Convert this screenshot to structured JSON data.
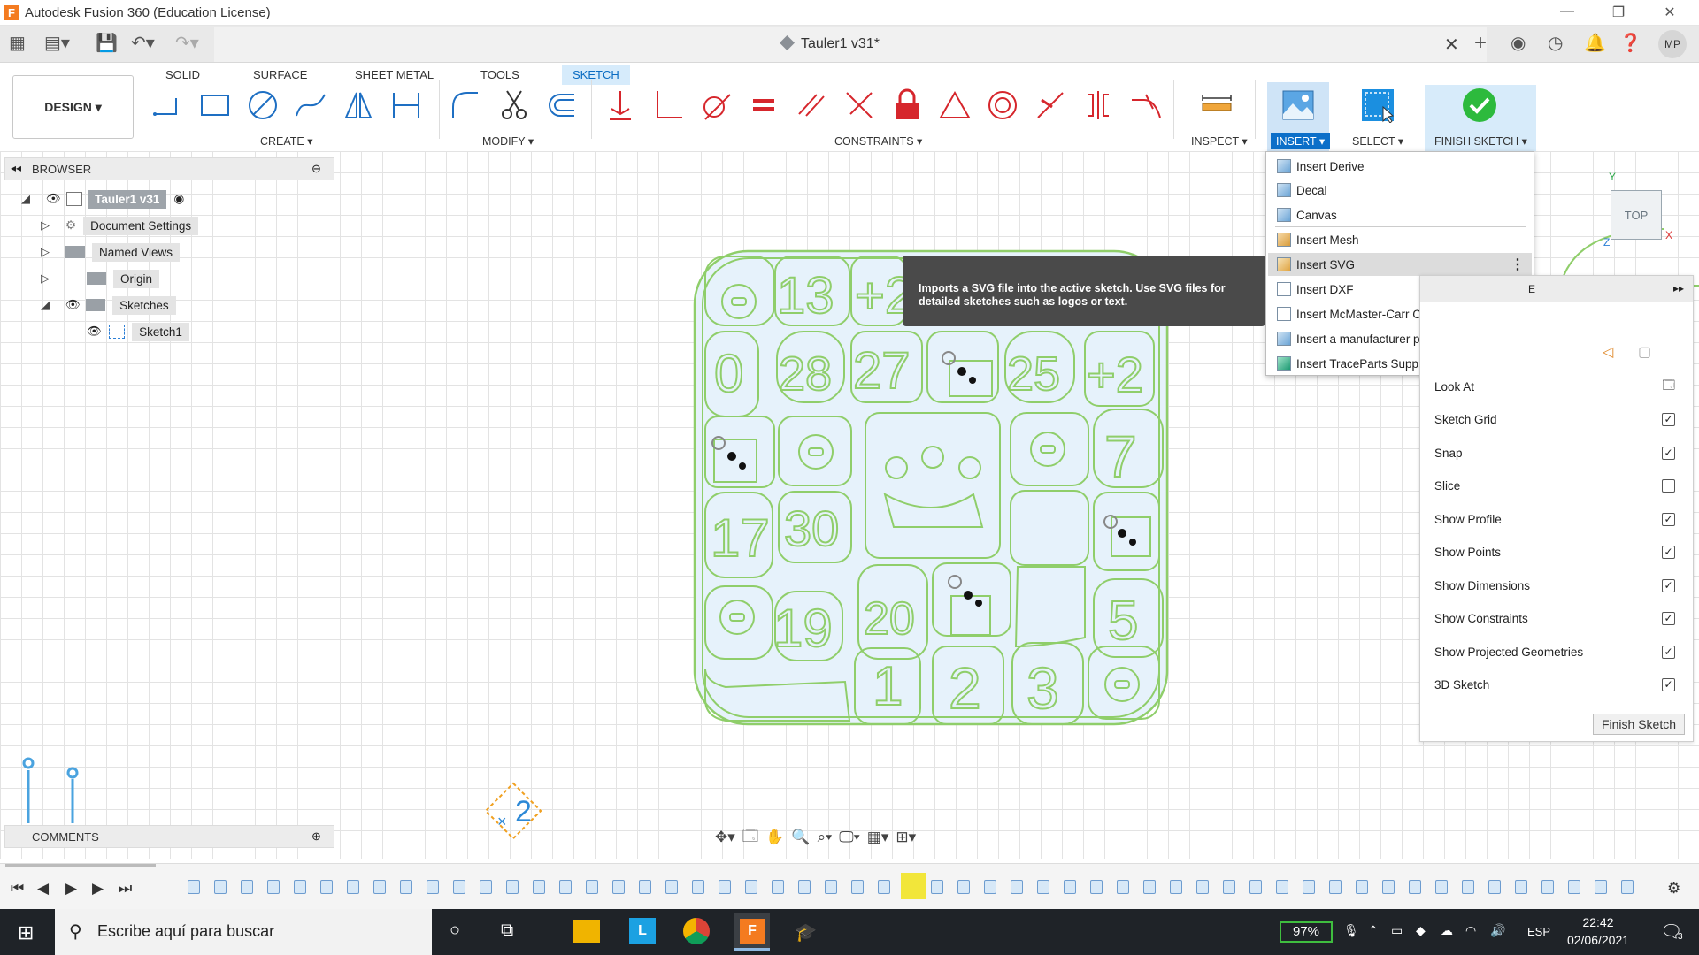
{
  "window": {
    "title": "Autodesk Fusion 360 (Education License)",
    "app_icon_letter": "F"
  },
  "document": {
    "tab_title": "Tauler1 v31*"
  },
  "user": {
    "initials": "MP"
  },
  "workspace": {
    "label": "DESIGN ▾"
  },
  "tabs": [
    {
      "label": "SOLID",
      "active": false
    },
    {
      "label": "SURFACE",
      "active": false
    },
    {
      "label": "SHEET METAL",
      "active": false
    },
    {
      "label": "TOOLS",
      "active": false
    },
    {
      "label": "SKETCH",
      "active": true
    }
  ],
  "groups": {
    "create": "CREATE ▾",
    "modify": "MODIFY ▾",
    "constraints": "CONSTRAINTS ▾",
    "inspect": "INSPECT ▾",
    "insert": "INSERT ▾",
    "select": "SELECT ▾",
    "finish": "FINISH SKETCH ▾"
  },
  "browser": {
    "title": "BROWSER",
    "items": [
      {
        "label": "Tauler1 v31",
        "icon": "component-icon",
        "expander": "◢"
      },
      {
        "label": "Document Settings",
        "icon": "gear-icon",
        "expander": "▷"
      },
      {
        "label": "Named Views",
        "icon": "folder-icon",
        "expander": "▷"
      },
      {
        "label": "Origin",
        "icon": "folder-icon",
        "expander": "▷"
      },
      {
        "label": "Sketches",
        "icon": "folder-icon",
        "expander": "◢"
      },
      {
        "label": "Sketch1",
        "icon": "sketch-icon",
        "expander": ""
      }
    ]
  },
  "comments": {
    "title": "COMMENTS"
  },
  "insert_menu": {
    "items": [
      {
        "label": "Insert Derive"
      },
      {
        "label": "Decal"
      },
      {
        "label": "Canvas"
      },
      {
        "label": "Insert Mesh"
      },
      {
        "label": "Insert SVG",
        "highlighted": true
      },
      {
        "label": "Insert DXF"
      },
      {
        "label": "Insert McMaster-Carr Component"
      },
      {
        "label": "Insert a manufacturer part"
      },
      {
        "label": "Insert TraceParts Supplier Components"
      }
    ]
  },
  "tooltip": {
    "text": "Imports a SVG file into the active sketch. Use SVG files for detailed sketches such as logos or text."
  },
  "sketch_palette": {
    "header_fragment": "E",
    "options": [
      {
        "label": "Look At",
        "checked": null
      },
      {
        "label": "Sketch Grid",
        "checked": true
      },
      {
        "label": "Snap",
        "checked": true
      },
      {
        "label": "Slice",
        "checked": false
      },
      {
        "label": "Show Profile",
        "checked": true
      },
      {
        "label": "Show Points",
        "checked": true
      },
      {
        "label": "Show Dimensions",
        "checked": true
      },
      {
        "label": "Show Constraints",
        "checked": true
      },
      {
        "label": "Show Projected Geometries",
        "checked": true
      },
      {
        "label": "3D Sketch",
        "checked": true
      }
    ],
    "finish_button": "Finish Sketch"
  },
  "viewcube": {
    "face": "TOP",
    "axis_x": "X",
    "axis_y": "Y",
    "axis_z": "Z"
  },
  "board": {
    "tiles": [
      "13",
      "+2",
      "0",
      "28",
      "27",
      "25",
      "+2",
      "7",
      "30",
      "17",
      "19",
      "20",
      "5",
      "1",
      "2",
      "3"
    ],
    "badge": "2"
  },
  "taskbar": {
    "search_placeholder": "Escribe aquí para buscar",
    "battery": "97%",
    "language": "ESP",
    "time": "22:42",
    "date": "02/06/2021",
    "notifications": "3"
  },
  "colors": {
    "accent": "#0c6fc9",
    "sketch_line": "#8fce6a",
    "profile_fill": "#e6f2fb",
    "constraint_red": "#d6262c"
  }
}
